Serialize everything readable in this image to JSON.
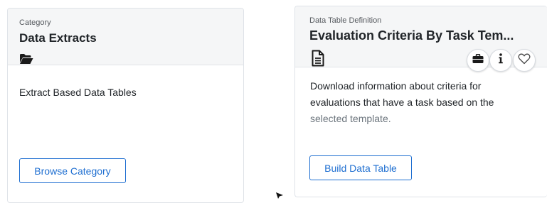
{
  "category_card": {
    "kicker": "Category",
    "title": "Data Extracts",
    "icon": "folder-open-icon",
    "description": "Extract Based Data Tables",
    "button_label": "Browse Category"
  },
  "data_table_card": {
    "kicker": "Data Table Definition",
    "title": "Evaluation Criteria By Task Tem...",
    "icon": "document-icon",
    "description_line1": "Download information about criteria for",
    "description_line2": "evaluations that have a task based on the",
    "description_line3": "selected template.",
    "button_label": "Build Data Table",
    "actions": [
      "briefcase-icon",
      "info-icon",
      "heart-outline-icon"
    ]
  },
  "colors": {
    "accent": "#1f6fd1",
    "header_bg": "#f5f6f7",
    "border": "#dfe3e8"
  }
}
